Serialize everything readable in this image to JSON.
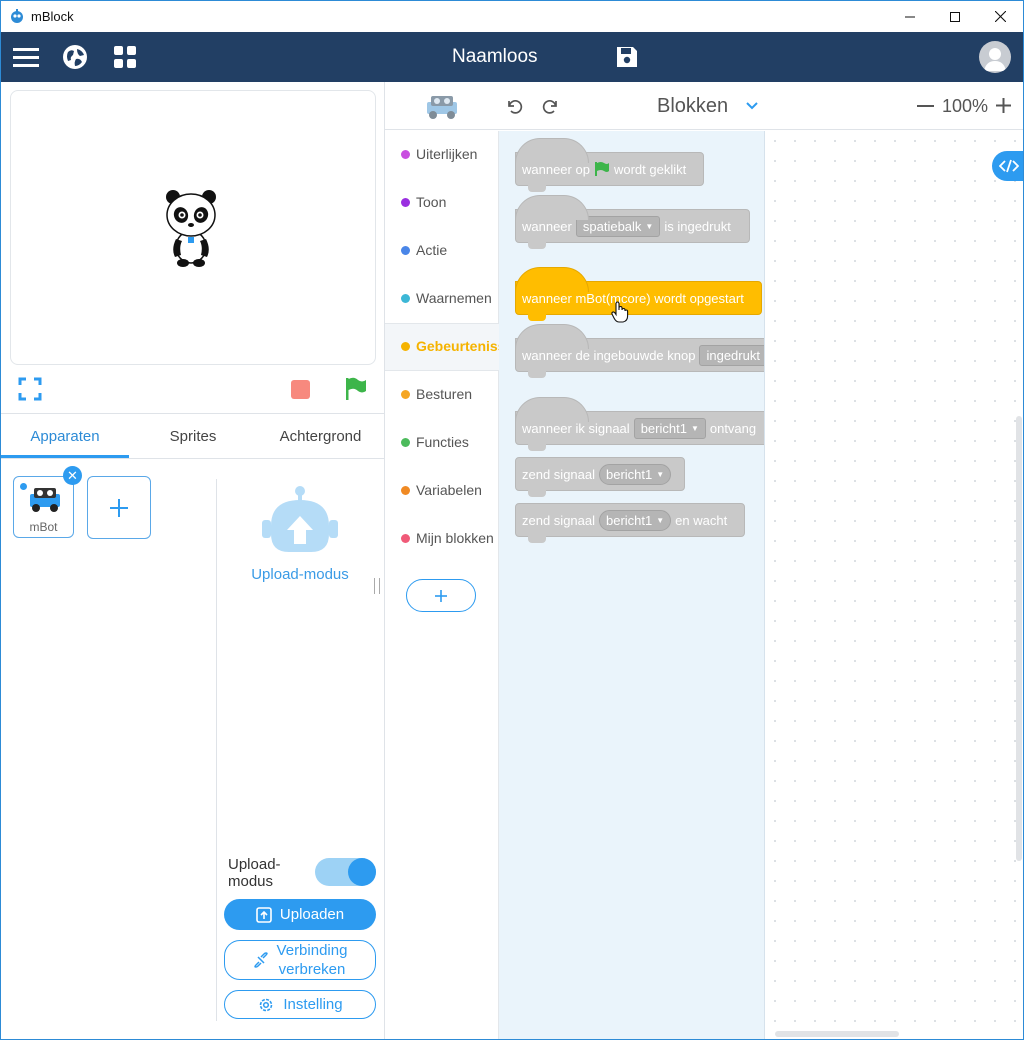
{
  "window": {
    "title": "mBlock",
    "controls": [
      "minimize-icon",
      "maximize-icon",
      "close-icon"
    ]
  },
  "menubar": {
    "project_title": "Naamloos",
    "icons": [
      "menu-icon",
      "globe-icon",
      "grid-icon",
      "save-icon",
      "avatar-icon"
    ]
  },
  "stage": {
    "controls": [
      "fullscreen-icon",
      "stop-icon",
      "green-flag-icon"
    ]
  },
  "tabs": [
    {
      "label": "Apparaten",
      "active": true
    },
    {
      "label": "Sprites",
      "active": false
    },
    {
      "label": "Achtergrond",
      "active": false
    }
  ],
  "devices": {
    "items": [
      {
        "label": "mBot"
      }
    ],
    "upload_mode_label": "Upload-modus"
  },
  "upload_panel": {
    "toggle_label_line1": "Upload-",
    "toggle_label_line2": "modus",
    "toggle_on": true,
    "upload_button": "Uploaden",
    "disconnect_line1": "Verbinding",
    "disconnect_line2": "verbreken",
    "settings_button": "Instelling"
  },
  "editor": {
    "mode": "Blokken",
    "zoom": "100%"
  },
  "categories": [
    {
      "label": "Uiterlijken",
      "color": "#c94fe0"
    },
    {
      "label": "Toon",
      "color": "#9a2fe0"
    },
    {
      "label": "Actie",
      "color": "#4a86e8"
    },
    {
      "label": "Waarnemen",
      "color": "#3cb7d6"
    },
    {
      "label": "Gebeurtenissen",
      "color": "#f5b300",
      "active": true
    },
    {
      "label": "Besturen",
      "color": "#f5a623"
    },
    {
      "label": "Functies",
      "color": "#4cbb5c"
    },
    {
      "label": "Variabelen",
      "color": "#f08a24"
    },
    {
      "label": "Mijn blokken",
      "color": "#f05a78"
    }
  ],
  "blocks": {
    "b1": {
      "pre": "wanneer op",
      "post": "wordt geklikt"
    },
    "b2": {
      "pre": "wanneer",
      "dropdown": "spatiebalk",
      "post": "is ingedrukt"
    },
    "b3": {
      "text": "wanneer mBot(mcore) wordt opgestart"
    },
    "b4": {
      "pre": "wanneer de ingebouwde knop",
      "dropdown": "ingedrukt"
    },
    "b5": {
      "pre": "wanneer ik signaal",
      "dropdown": "bericht1",
      "post": "ontvang"
    },
    "b6": {
      "pre": "zend signaal",
      "dropdown": "bericht1"
    },
    "b7": {
      "pre": "zend signaal",
      "dropdown": "bericht1",
      "post": "en wacht"
    }
  }
}
